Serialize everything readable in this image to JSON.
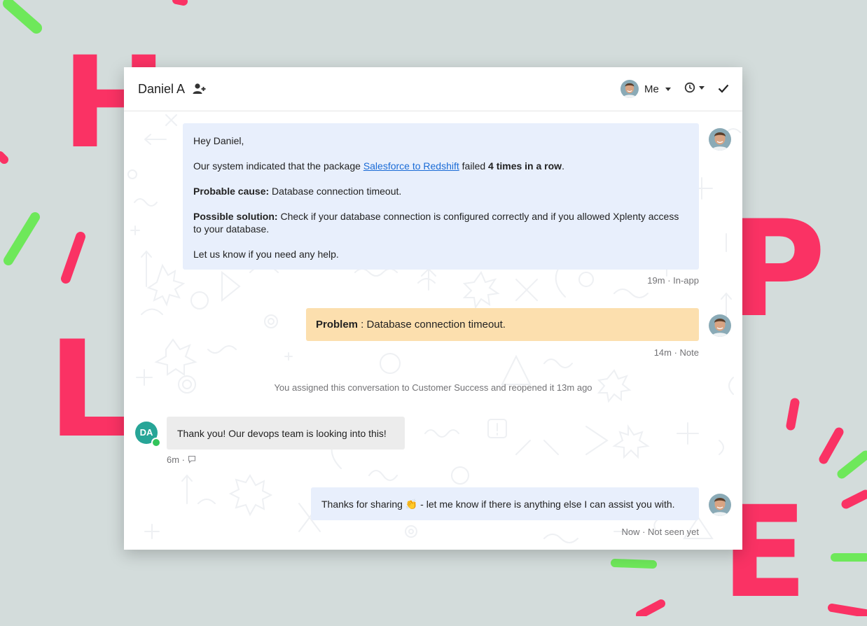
{
  "background": {
    "letters": [
      "H",
      "L",
      "P",
      "E"
    ],
    "letter_color": "#fa3264",
    "accent_colors": [
      "#fa3264",
      "#6ee85a"
    ]
  },
  "header": {
    "contact_name": "Daniel A",
    "add_participant_icon": "person-add-icon",
    "assignee_label": "Me",
    "snooze_icon": "clock-icon",
    "close_icon": "checkmark-icon"
  },
  "messages": [
    {
      "greeting": "Hey Daniel,",
      "line2_pre": "Our system indicated that the package ",
      "line2_link": "Salesforce to Redshift",
      "line2_mid": " failed ",
      "line2_bold": "4 times in a row",
      "line2_post": ".",
      "cause_label": "Probable cause:",
      "cause_text": " Database connection timeout.",
      "solution_label": "Possible solution:",
      "solution_text": " Check if your database connection is configured correctly and if you allowed Xplenty access to your database.",
      "closing": "Let us know if you need any help.",
      "meta": "19m · In-app",
      "bubble_color": "#e8effc"
    },
    {
      "label": "Problem",
      "text": " : Database connection timeout.",
      "meta": "14m · Note",
      "bubble_color": "#fcdfae"
    },
    {
      "text": "Thank you! Our devops team is looking into this!",
      "meta": "6m ·",
      "author_initials": "DA",
      "avatar_color": "#27a597",
      "bubble_color": "#ececec"
    },
    {
      "text_pre": "Thanks for sharing ",
      "emoji": "👏",
      "text_post": " - let me know if there is anything else I can assist you with.",
      "meta": "Now · Not seen yet",
      "bubble_color": "#e8effc"
    }
  ],
  "system_event": "You assigned this conversation to Customer Success and reopened it 13m ago"
}
